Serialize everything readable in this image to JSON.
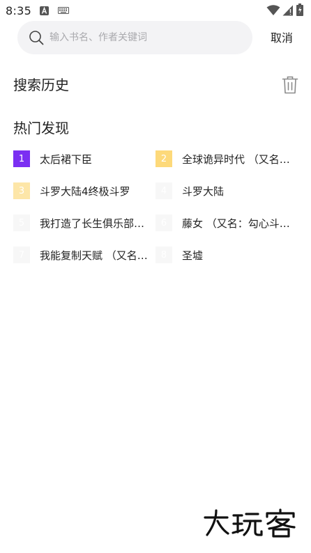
{
  "status_bar": {
    "time": "8:35",
    "icons": [
      "notification-a-icon",
      "keyboard-icon",
      "wifi-icon",
      "signal-icon",
      "battery-icon"
    ]
  },
  "search": {
    "placeholder": "输入书名、作者关键词",
    "value": "",
    "cancel_label": "取消"
  },
  "history": {
    "title": "搜索历史",
    "clear_icon": "trash-icon"
  },
  "hot": {
    "title": "热门发现",
    "items": [
      {
        "rank": "1",
        "title": "太后裙下臣",
        "rank_bg": "#7b2ff2",
        "rank_color": "#ffffff"
      },
      {
        "rank": "2",
        "title": "全球诡异时代 （又名…",
        "rank_bg": "#fdd97a",
        "rank_color": "#ffffff"
      },
      {
        "rank": "3",
        "title": "斗罗大陆4终极斗罗",
        "rank_bg": "#fde6a8",
        "rank_color": "#ffffff"
      },
      {
        "rank": "4",
        "title": "斗罗大陆",
        "rank_bg": "#f7f7f7",
        "rank_color": "#ffffff"
      },
      {
        "rank": "5",
        "title": "我打造了长生俱乐部…",
        "rank_bg": "#f7f7f7",
        "rank_color": "#ffffff"
      },
      {
        "rank": "6",
        "title": "藤女 （又名：勾心斗…",
        "rank_bg": "#f7f7f7",
        "rank_color": "#ffffff"
      },
      {
        "rank": "7",
        "title": "我能复制天赋 （又名…",
        "rank_bg": "#f7f7f7",
        "rank_color": "#ffffff"
      },
      {
        "rank": "8",
        "title": "圣墟",
        "rank_bg": "#f7f7f7",
        "rank_color": "#ffffff"
      }
    ]
  },
  "watermark": {
    "text": "大玩客"
  }
}
